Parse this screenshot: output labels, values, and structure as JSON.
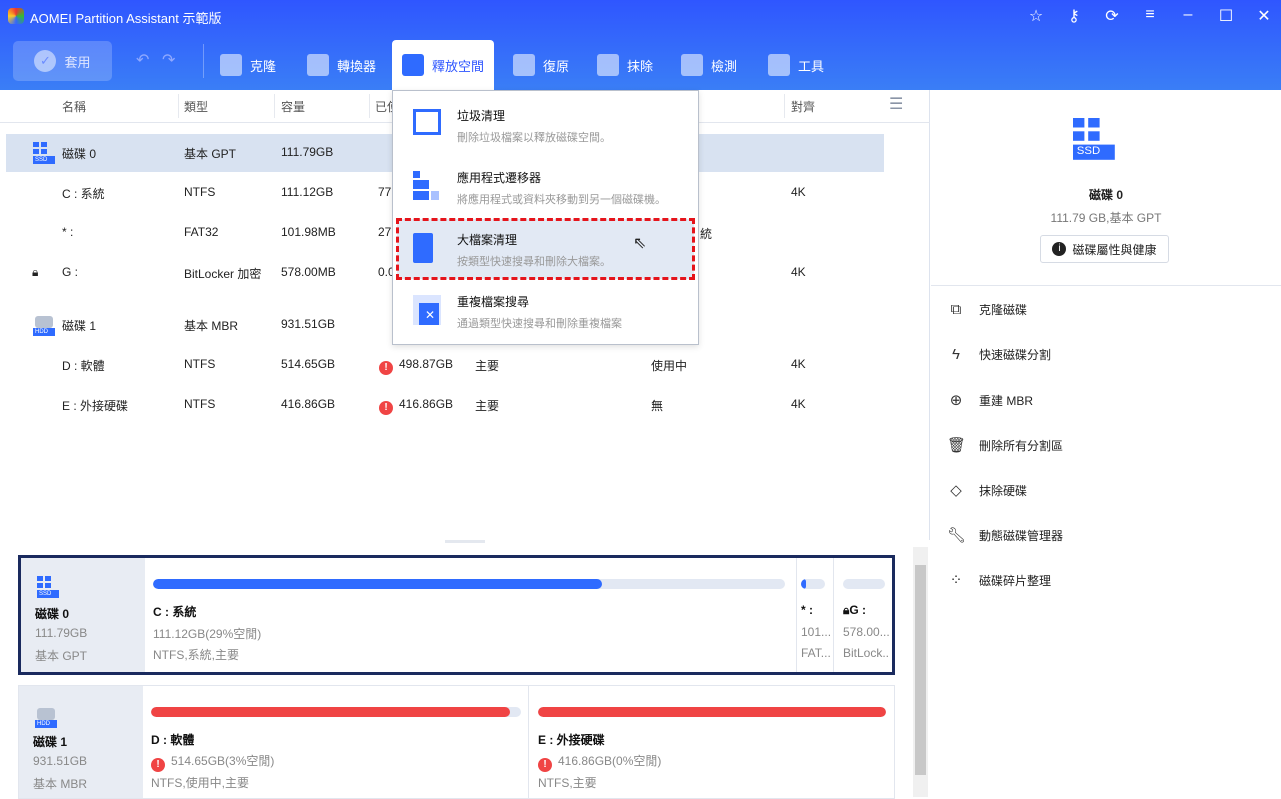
{
  "titlebar": {
    "title": "AOMEI Partition Assistant 示範版",
    "icons": [
      "star-icon",
      "key-icon",
      "refresh-icon",
      "menu-icon",
      "minimize-icon",
      "maximize-icon",
      "close-icon"
    ]
  },
  "toolbar": {
    "apply": "套用",
    "items": [
      {
        "label": "克隆"
      },
      {
        "label": "轉換器"
      },
      {
        "label": "釋放空間"
      },
      {
        "label": "復原"
      },
      {
        "label": "抹除"
      },
      {
        "label": "檢測"
      },
      {
        "label": "工具"
      }
    ]
  },
  "table": {
    "headers": {
      "name": "名稱",
      "type": "類型",
      "capacity": "容量",
      "used": "已使",
      "align": "對齊"
    },
    "rows": [
      {
        "name": "磁碟 0",
        "type": "基本 GPT",
        "capacity": "111.79GB",
        "used": "",
        "fs": "",
        "status": "",
        "align": ""
      },
      {
        "name": "C : 系統",
        "type": "NTFS",
        "capacity": "111.12GB",
        "used": "77",
        "fs": "",
        "status": "",
        "align": "4K"
      },
      {
        "name": "* :",
        "type": "FAT32",
        "capacity": "101.98MB",
        "used": "27",
        "fs": "",
        "status": "統",
        "align": ""
      },
      {
        "name": "G :",
        "type": "BitLocker 加密",
        "capacity": "578.00MB",
        "used": "0.0",
        "fs": "",
        "status": "",
        "align": "4K"
      },
      {
        "name": "磁碟 1",
        "type": "基本 MBR",
        "capacity": "931.51GB",
        "used": "",
        "fs": "",
        "status": "",
        "align": ""
      },
      {
        "name": "D : 軟體",
        "type": "NTFS",
        "capacity": "514.65GB",
        "used": "498.87GB",
        "fs": "主要",
        "status": "使用中",
        "align": "4K"
      },
      {
        "name": "E : 外接硬碟",
        "type": "NTFS",
        "capacity": "416.86GB",
        "used": "416.86GB",
        "fs": "主要",
        "status": "無",
        "align": "4K"
      }
    ]
  },
  "menu": {
    "items": [
      {
        "title": "垃圾清理",
        "desc": "刪除垃圾檔案以釋放磁碟空間。"
      },
      {
        "title": "應用程式遷移器",
        "desc": "將應用程式或資料夾移動到另一個磁碟機。"
      },
      {
        "title": "大檔案清理",
        "desc": "按類型快速搜尋和刪除大檔案。"
      },
      {
        "title": "重複檔案搜尋",
        "desc": "通過類型快速搜尋和刪除重複檔案"
      }
    ]
  },
  "right": {
    "disk_name": "磁碟 0",
    "disk_info": "111.79 GB,基本 GPT",
    "props_button": "磁碟屬性與健康",
    "ops": [
      "克隆磁碟",
      "快速磁碟分割",
      "重建 MBR",
      "刪除所有分割區",
      "抹除硬碟",
      "動態磁碟管理器",
      "磁碟碎片整理"
    ]
  },
  "map": {
    "disks": [
      {
        "name": "磁碟 0",
        "size": "111.79GB",
        "type": "基本 GPT",
        "parts": [
          {
            "label": "C : 系統",
            "size": "111.12GB(29%空閒)",
            "info": "NTFS,系統,主要",
            "used_pct": 71
          },
          {
            "label": "* :",
            "size": "101...",
            "info": "FAT...",
            "used_pct": 20
          },
          {
            "label": "G :",
            "size": "578.00...",
            "info": "BitLock...",
            "used_pct": 0
          }
        ]
      },
      {
        "name": "磁碟 1",
        "size": "931.51GB",
        "type": "基本 MBR",
        "parts": [
          {
            "label": "D : 軟體",
            "size": "514.65GB(3%空閒)",
            "info": "NTFS,使用中,主要",
            "used_pct": 97
          },
          {
            "label": "E : 外接硬碟",
            "size": "416.86GB(0%空閒)",
            "info": "NTFS,主要",
            "used_pct": 100
          }
        ]
      }
    ]
  },
  "colors": {
    "accent": "#2f6bff",
    "danger": "#f04444",
    "selected": "#d8e2f1"
  }
}
